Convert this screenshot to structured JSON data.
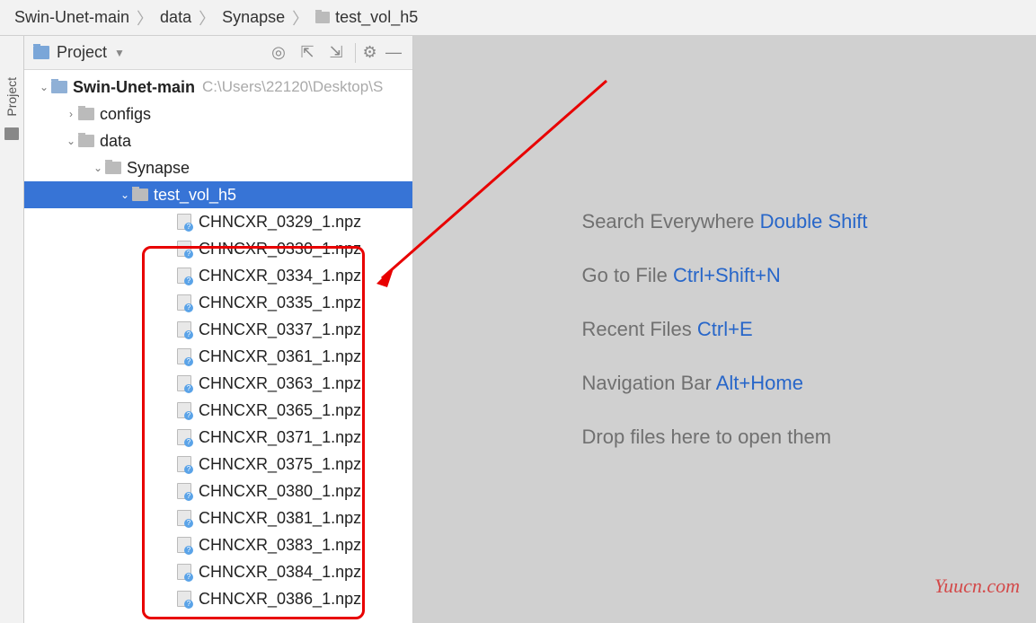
{
  "breadcrumb": {
    "items": [
      "Swin-Unet-main",
      "data",
      "Synapse",
      "test_vol_h5"
    ]
  },
  "sidebar_tab": {
    "label": "Project"
  },
  "pane": {
    "title": "Project",
    "root_name": "Swin-Unet-main",
    "root_path": "C:\\Users\\22120\\Desktop\\S",
    "tree": {
      "configs": "configs",
      "data": "data",
      "synapse": "Synapse",
      "test_vol": "test_vol_h5"
    },
    "files": [
      "CHNCXR_0329_1.npz",
      "CHNCXR_0330_1.npz",
      "CHNCXR_0334_1.npz",
      "CHNCXR_0335_1.npz",
      "CHNCXR_0337_1.npz",
      "CHNCXR_0361_1.npz",
      "CHNCXR_0363_1.npz",
      "CHNCXR_0365_1.npz",
      "CHNCXR_0371_1.npz",
      "CHNCXR_0375_1.npz",
      "CHNCXR_0380_1.npz",
      "CHNCXR_0381_1.npz",
      "CHNCXR_0383_1.npz",
      "CHNCXR_0384_1.npz",
      "CHNCXR_0386_1.npz"
    ]
  },
  "hints": {
    "search_label": "Search Everywhere ",
    "search_key": "Double Shift",
    "goto_label": "Go to File ",
    "goto_key": "Ctrl+Shift+N",
    "recent_label": "Recent Files ",
    "recent_key": "Ctrl+E",
    "nav_label": "Navigation Bar ",
    "nav_key": "Alt+Home",
    "drop": "Drop files here to open them"
  },
  "watermark": "Yuucn.com"
}
